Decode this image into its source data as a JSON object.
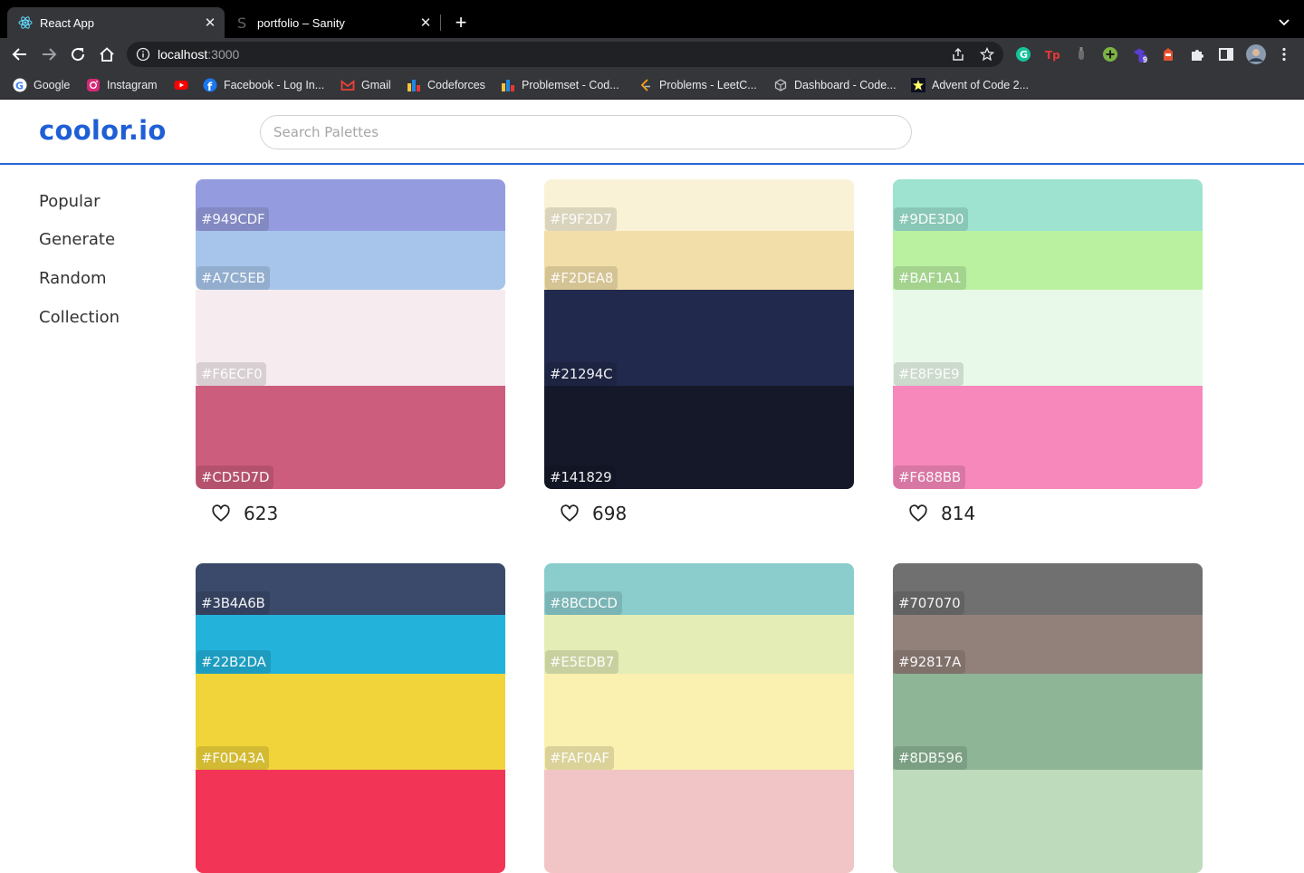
{
  "browser": {
    "tabs": [
      {
        "title": "React App",
        "active": true
      },
      {
        "title": "portfolio – Sanity",
        "active": false
      }
    ],
    "url_host": "localhost",
    "url_port": ":3000",
    "bookmarks": [
      "Google",
      "Instagram",
      "",
      "Facebook - Log In...",
      "Gmail",
      "Codeforces",
      "Problemset - Cod...",
      "Problems - LeetC...",
      "Dashboard - Code...",
      "Advent of Code 2..."
    ],
    "extension_badge": "9"
  },
  "app": {
    "logo": "coolor.io",
    "search_placeholder": "Search Palettes",
    "sidebar": [
      "Popular",
      "Generate",
      "Random",
      "Collection"
    ],
    "palettes": [
      {
        "colors": [
          "#949CDF",
          "#A7C5EB",
          "#F6ECF0",
          "#CD5D7D"
        ],
        "likes": "623"
      },
      {
        "colors": [
          "#F9F2D7",
          "#F2DEA8",
          "#21294C",
          "#141829"
        ],
        "likes": "698"
      },
      {
        "colors": [
          "#9DE3D0",
          "#BAF1A1",
          "#E8F9E9",
          "#F688BB"
        ],
        "likes": "814"
      },
      {
        "colors": [
          "#3B4A6B",
          "#22B2DA",
          "#F0D43A",
          "#F23557"
        ],
        "likes": ""
      },
      {
        "colors": [
          "#8BCDCD",
          "#E5EDB7",
          "#FAF0AF",
          "#F1C5C5"
        ],
        "likes": ""
      },
      {
        "colors": [
          "#707070",
          "#92817A",
          "#8DB596",
          "#BEDBBB"
        ],
        "likes": ""
      }
    ],
    "labels": [
      [
        "#949CDF",
        "#A7C5EB",
        "#F6ECF0",
        "#CD5D7D"
      ],
      [
        "#F9F2D7",
        "#F2DEA8",
        "#21294C",
        "#141829"
      ],
      [
        "#9DE3D0",
        "#BAF1A1",
        "#E8F9E9",
        "#F688BB"
      ],
      [
        "#3B4A6B",
        "#22B2DA",
        "#F0D43A"
      ],
      [
        "#8BCDCD",
        "#E5EDB7",
        "#FAF0AF"
      ],
      [
        "#707070",
        "#92817A",
        "#8DB596"
      ]
    ]
  }
}
